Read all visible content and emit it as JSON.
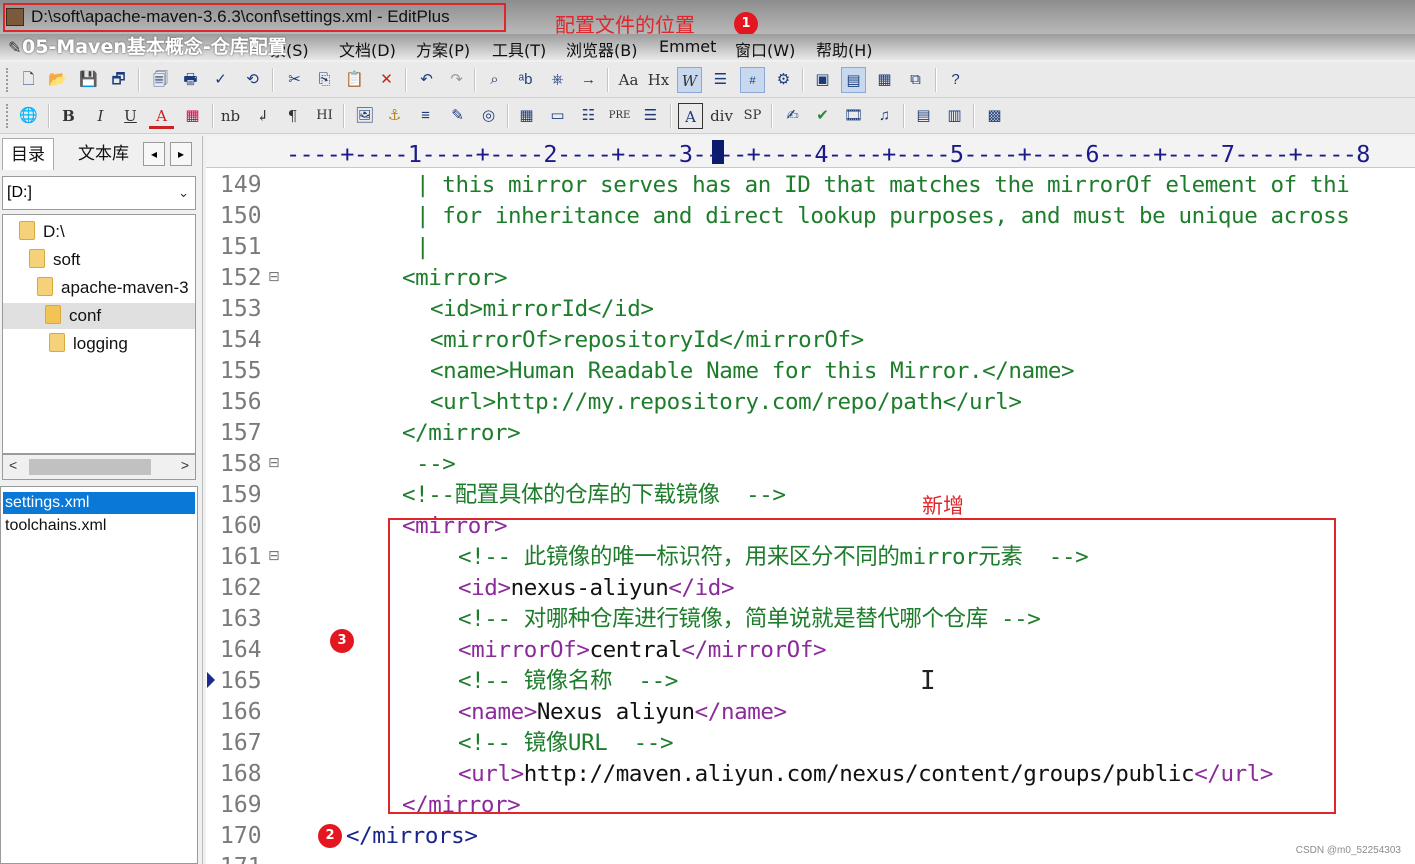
{
  "window": {
    "title": "D:\\soft\\apache-maven-3.6.3\\conf\\settings.xml - EditPlus",
    "video_overlay_title": "05-Maven基本概念-仓库配置"
  },
  "annotations": {
    "title_label": "配置文件的位置",
    "marker_1": "1",
    "marker_2": "2",
    "marker_3": "3",
    "new_label": "新增",
    "color": "#e0262b"
  },
  "menu": {
    "items": [
      "索(S)",
      "文档(D)",
      "方案(P)",
      "工具(T)",
      "浏览器(B)",
      "Emmet",
      "窗口(W)",
      "帮助(H)"
    ]
  },
  "toolbar2": {
    "bold": "B",
    "italic": "I",
    "underline": "U",
    "font_color": "A",
    "nb": "nb",
    "return": "↲",
    "para": "¶",
    "hi": "HI",
    "pre": "PRE",
    "div": "div",
    "sp": "SP"
  },
  "toolbar1": {
    "format_a": "Aa",
    "hx": "Hx",
    "w": "W"
  },
  "sidebar": {
    "tabs": [
      "目录",
      "文本库"
    ],
    "arrow_left": "◂",
    "arrow_right": "▸",
    "drive": "[D:]",
    "tree": [
      "D:\\",
      "soft",
      "apache-maven-3",
      "conf",
      "logging"
    ],
    "files": [
      "settings.xml",
      "toolchains.xml"
    ],
    "scroll_left": "<",
    "scroll_right": ">"
  },
  "editor": {
    "ruler": "----+----1----+----2----+----3----+----4----+----5----+----6----+----7----+----8",
    "line_numbers": [
      "149",
      "150",
      "151",
      "152",
      "153",
      "154",
      "155",
      "156",
      "157",
      "158",
      "159",
      "160",
      "161",
      "162",
      "163",
      "164",
      "165",
      "166",
      "167",
      "168",
      "169",
      "170",
      "171"
    ],
    "lines": [
      "| this mirror serves has an ID that matches the mirrorOf element of thi",
      "| for inheritance and direct lookup purposes, and must be unique across",
      "|",
      "<mirror>",
      "<id>mirrorId</id>",
      "<mirrorOf>repositoryId</mirrorOf>",
      "<name>Human Readable Name for this Mirror.</name>",
      "<url>http://my.repository.com/repo/path</url>",
      "</mirror>",
      "-->",
      "<!--配置具体的仓库的下载镜像  -->",
      "<mirror>",
      "<!-- 此镜像的唯一标识符，用来区分不同的mirror元素  -->",
      "<id>",
      "nexus-aliyun",
      "</id>",
      "<!-- 对哪种仓库进行镜像，简单说就是替代哪个仓库 -->",
      "<mirrorOf>",
      "central",
      "</mirrorOf>",
      "<!-- 镜像名称  -->",
      "<name>",
      "Nexus aliyun",
      "</name>",
      "<!-- 镜像URL  -->",
      "<url>",
      "http://maven.aliyun.com/nexus/content/groups/public",
      "</url>",
      "</mirror>",
      "</mirrors>"
    ],
    "colors": {
      "comment": "#1d7d2b",
      "tag": "#8b2a9b",
      "new_tag": "#0b2bd9",
      "text": "#111111"
    }
  },
  "watermark": "CSDN @m0_52254303"
}
